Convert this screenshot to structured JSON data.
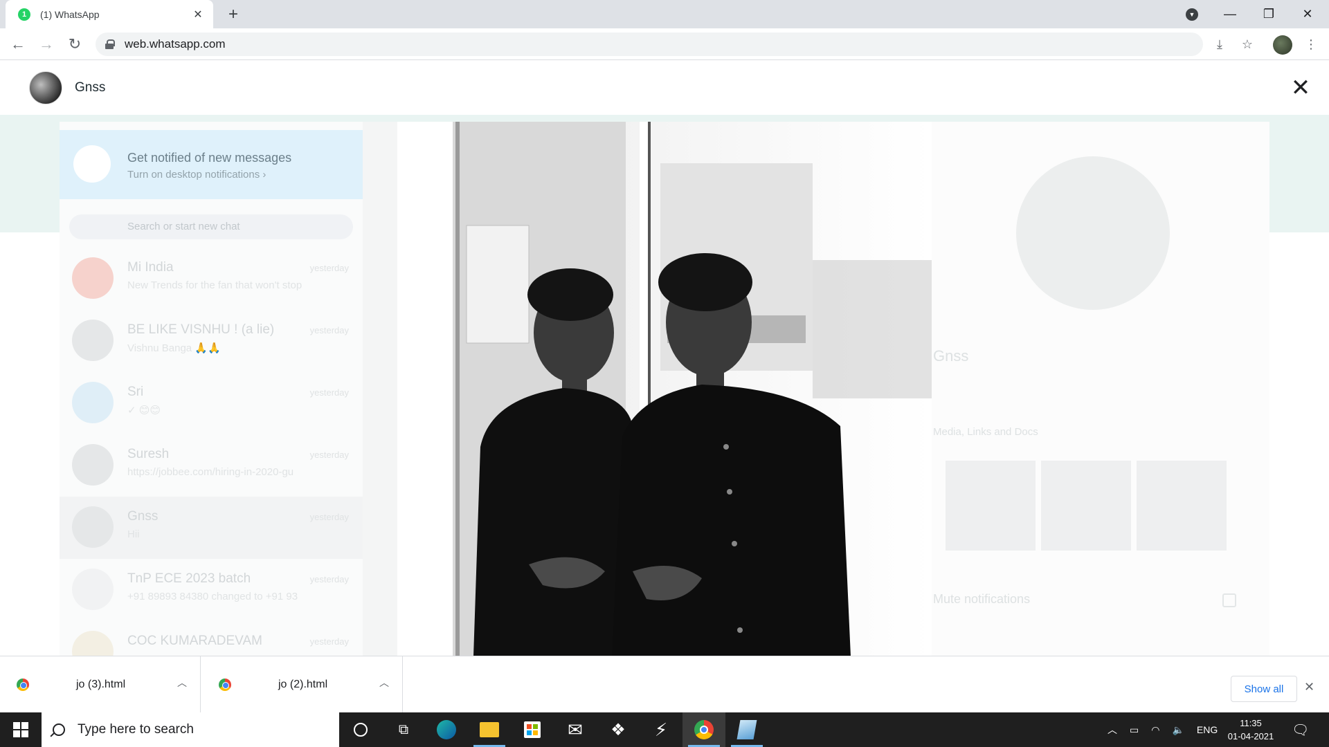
{
  "browser": {
    "tab_title": "(1) WhatsApp",
    "tab_badge": "1",
    "url": "web.whatsapp.com"
  },
  "viewer": {
    "contact_name": "Gnss"
  },
  "background": {
    "notice_title": "Get notified of new messages",
    "notice_sub": "Turn on desktop notifications ›",
    "search_placeholder": "Search or start new chat",
    "chats": [
      {
        "name": "Mi India",
        "time": "yesterday",
        "message": "New Trends for the fan that won't stop"
      },
      {
        "name": "BE LIKE VISNHU ! (a lie)",
        "time": "yesterday",
        "message": "Vishnu Banga 🙏🙏"
      },
      {
        "name": "Sri",
        "time": "yesterday",
        "message": "✓ 😊😊"
      },
      {
        "name": "Suresh",
        "time": "yesterday",
        "message": "https://jobbee.com/hiring-in-2020-gu"
      },
      {
        "name": "Gnss",
        "time": "yesterday",
        "message": "Hii"
      },
      {
        "name": "TnP ECE 2023 batch",
        "time": "yesterday",
        "message": "+91 89893 84380 changed to +91 93"
      },
      {
        "name": "COC KUMARADEVAM",
        "time": "yesterday",
        "message": ""
      }
    ],
    "right_name": "Gnss",
    "media_label": "Media, Links and Docs",
    "mute_label": "Mute notifications"
  },
  "downloads": {
    "items": [
      {
        "name": "jo (3).html"
      },
      {
        "name": "jo (2).html"
      }
    ],
    "show_all": "Show all"
  },
  "taskbar": {
    "search_placeholder": "Type here to search",
    "language": "ENG",
    "time": "11:35",
    "date": "01-04-2021"
  },
  "colors": {
    "whatsapp_green": "#25d366",
    "link_blue": "#1a73e8",
    "taskbar": "#1f1f1f"
  }
}
